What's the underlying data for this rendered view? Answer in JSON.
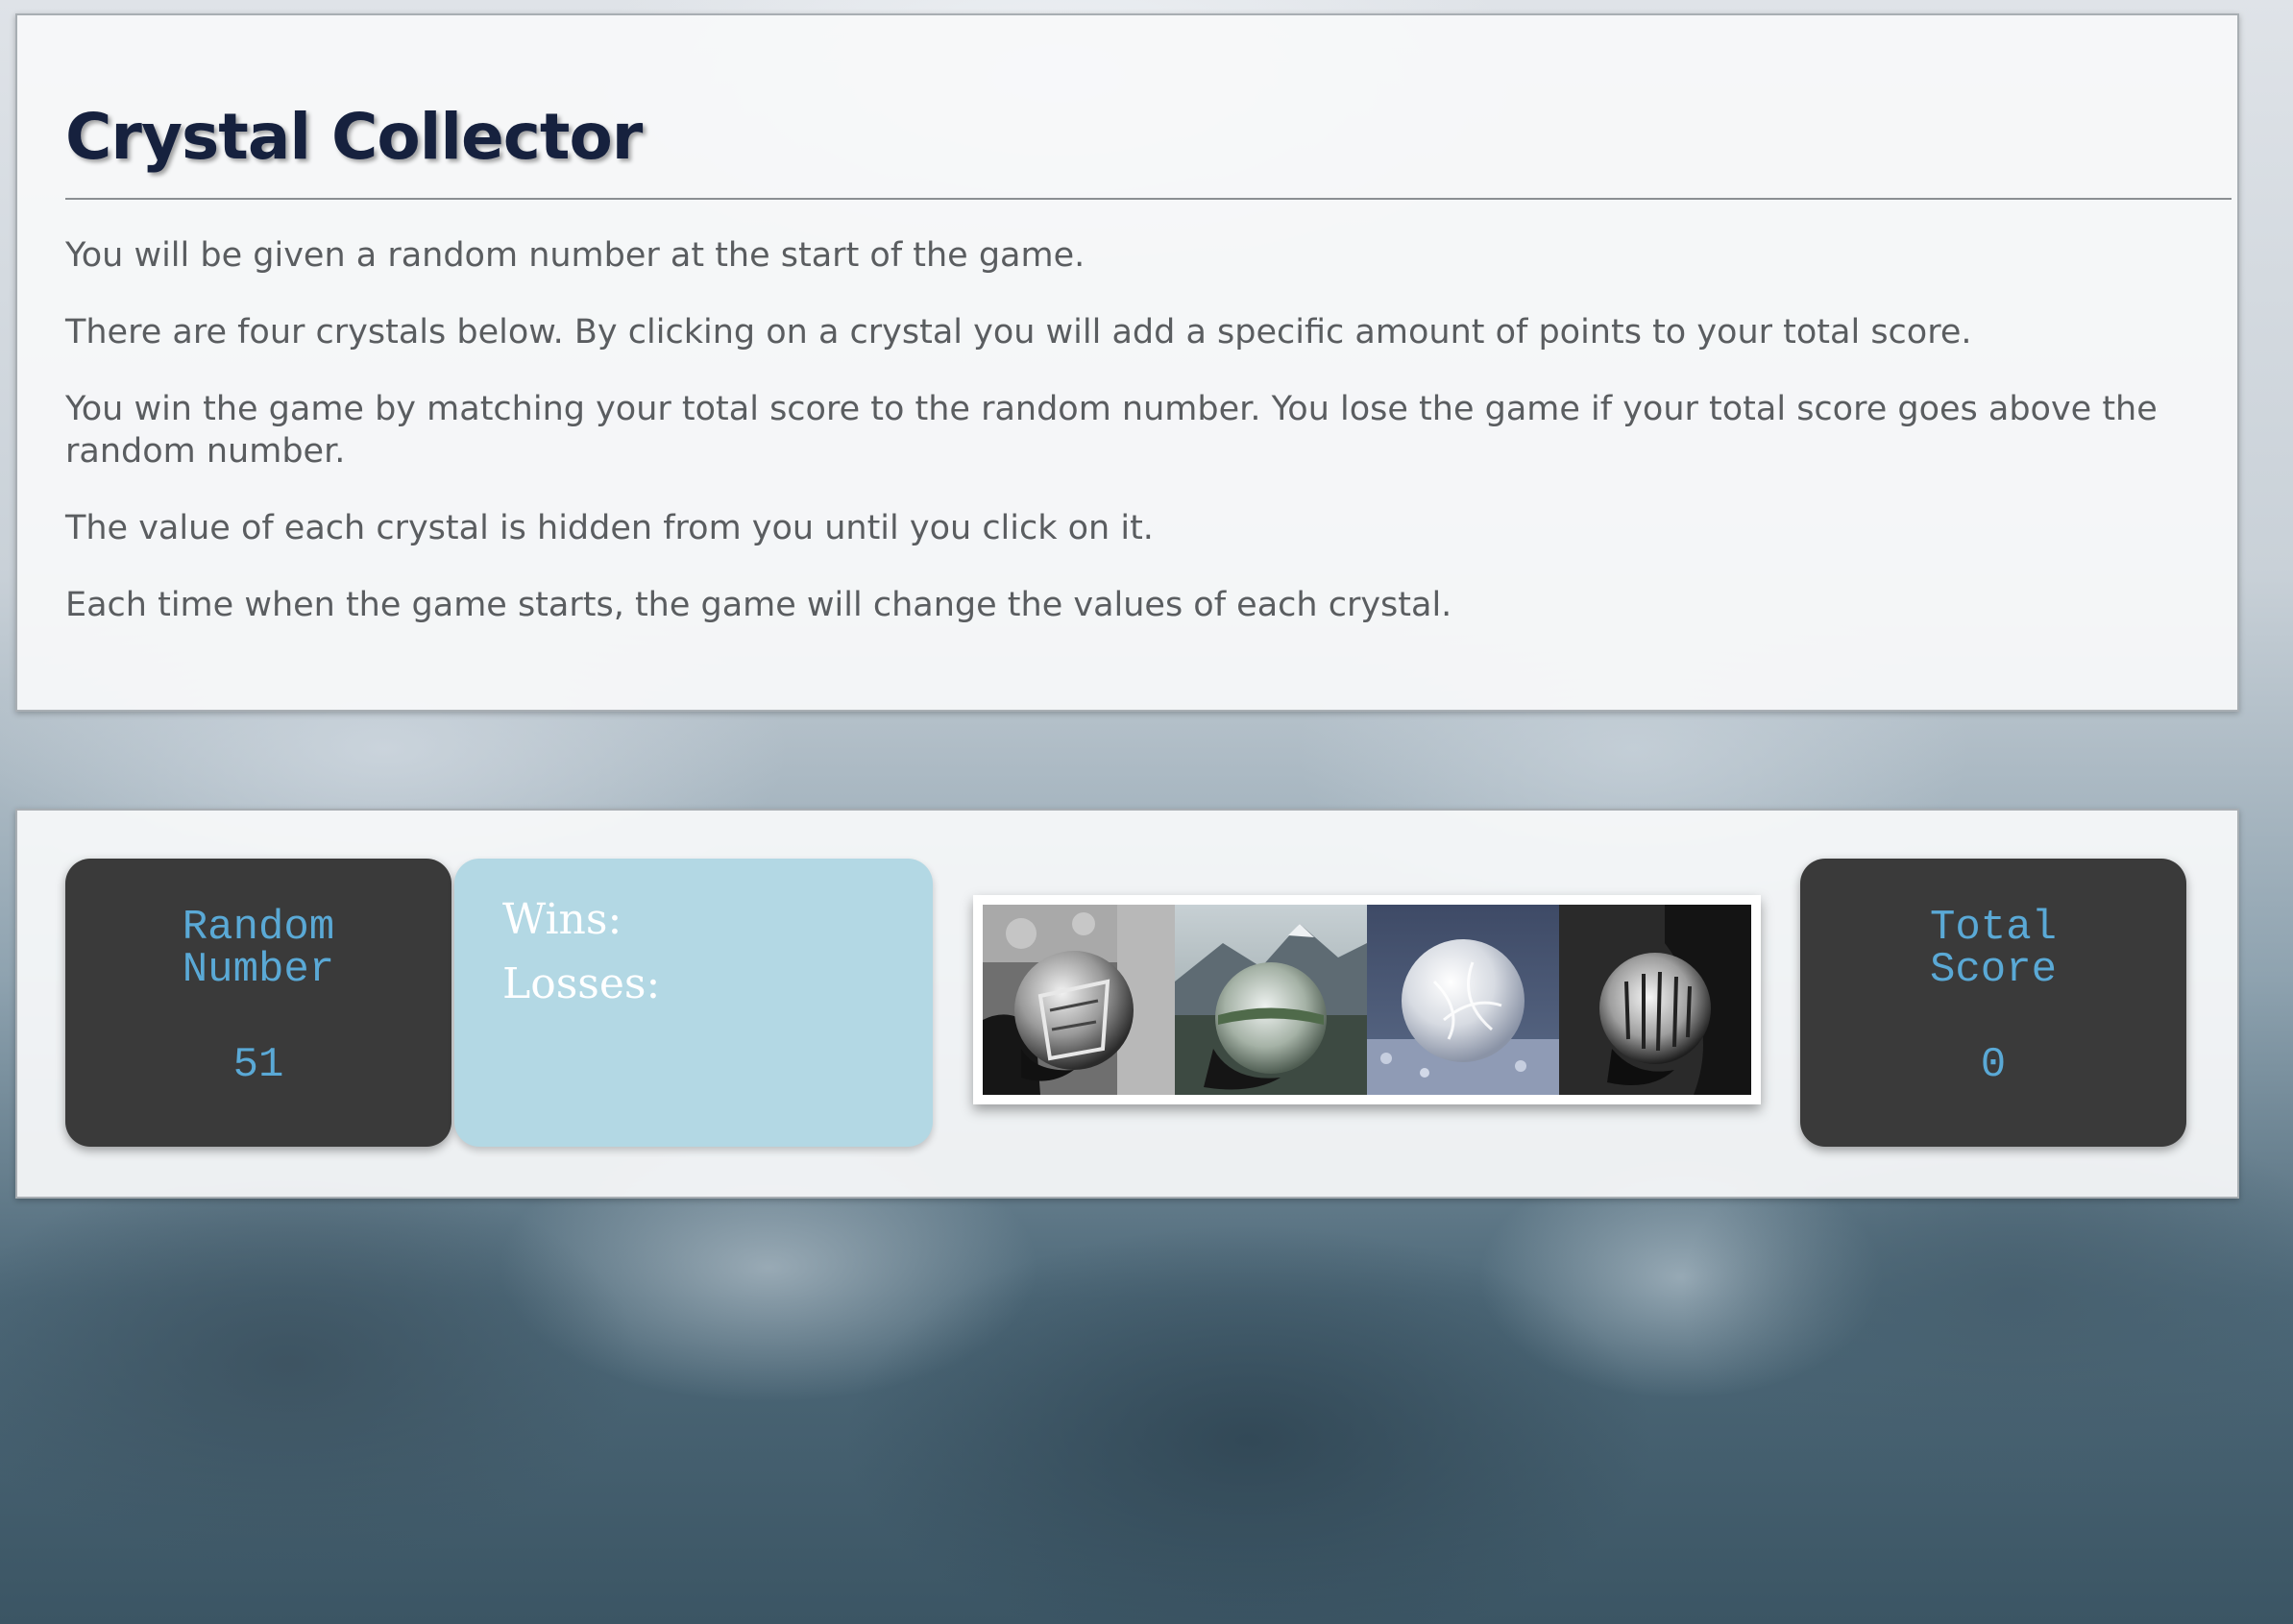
{
  "intro": {
    "title": "Crystal Collector",
    "paragraphs": [
      "You will be given a random number at the start of the game.",
      "There are four crystals below. By clicking on a crystal you will add a specific amount of points to your total score.",
      "You win the game by matching your total score to the random number. You lose the game if your total score goes above the random number.",
      "The value of each crystal is hidden from you until you click on it.",
      "Each time when the game starts, the game will change the values of each crystal."
    ]
  },
  "game": {
    "random_number": {
      "label": "Random Number",
      "value": "51"
    },
    "scoreboard": {
      "wins_label": "Wins:",
      "losses_label": "Losses:"
    },
    "crystals": [
      {
        "name": "crystal-ball-building",
        "icon": "crystal-ball-icon"
      },
      {
        "name": "crystal-ball-mountain",
        "icon": "crystal-ball-icon"
      },
      {
        "name": "crystal-ball-frost",
        "icon": "crystal-ball-icon"
      },
      {
        "name": "crystal-ball-forest",
        "icon": "crystal-ball-icon"
      }
    ],
    "total_score": {
      "label": "Total Score",
      "value": "0"
    }
  },
  "colors": {
    "title": "#16213e",
    "accent_text": "#5aa9d6",
    "dark_box": "#3a3a3a",
    "score_box": "#b3d8e4"
  }
}
